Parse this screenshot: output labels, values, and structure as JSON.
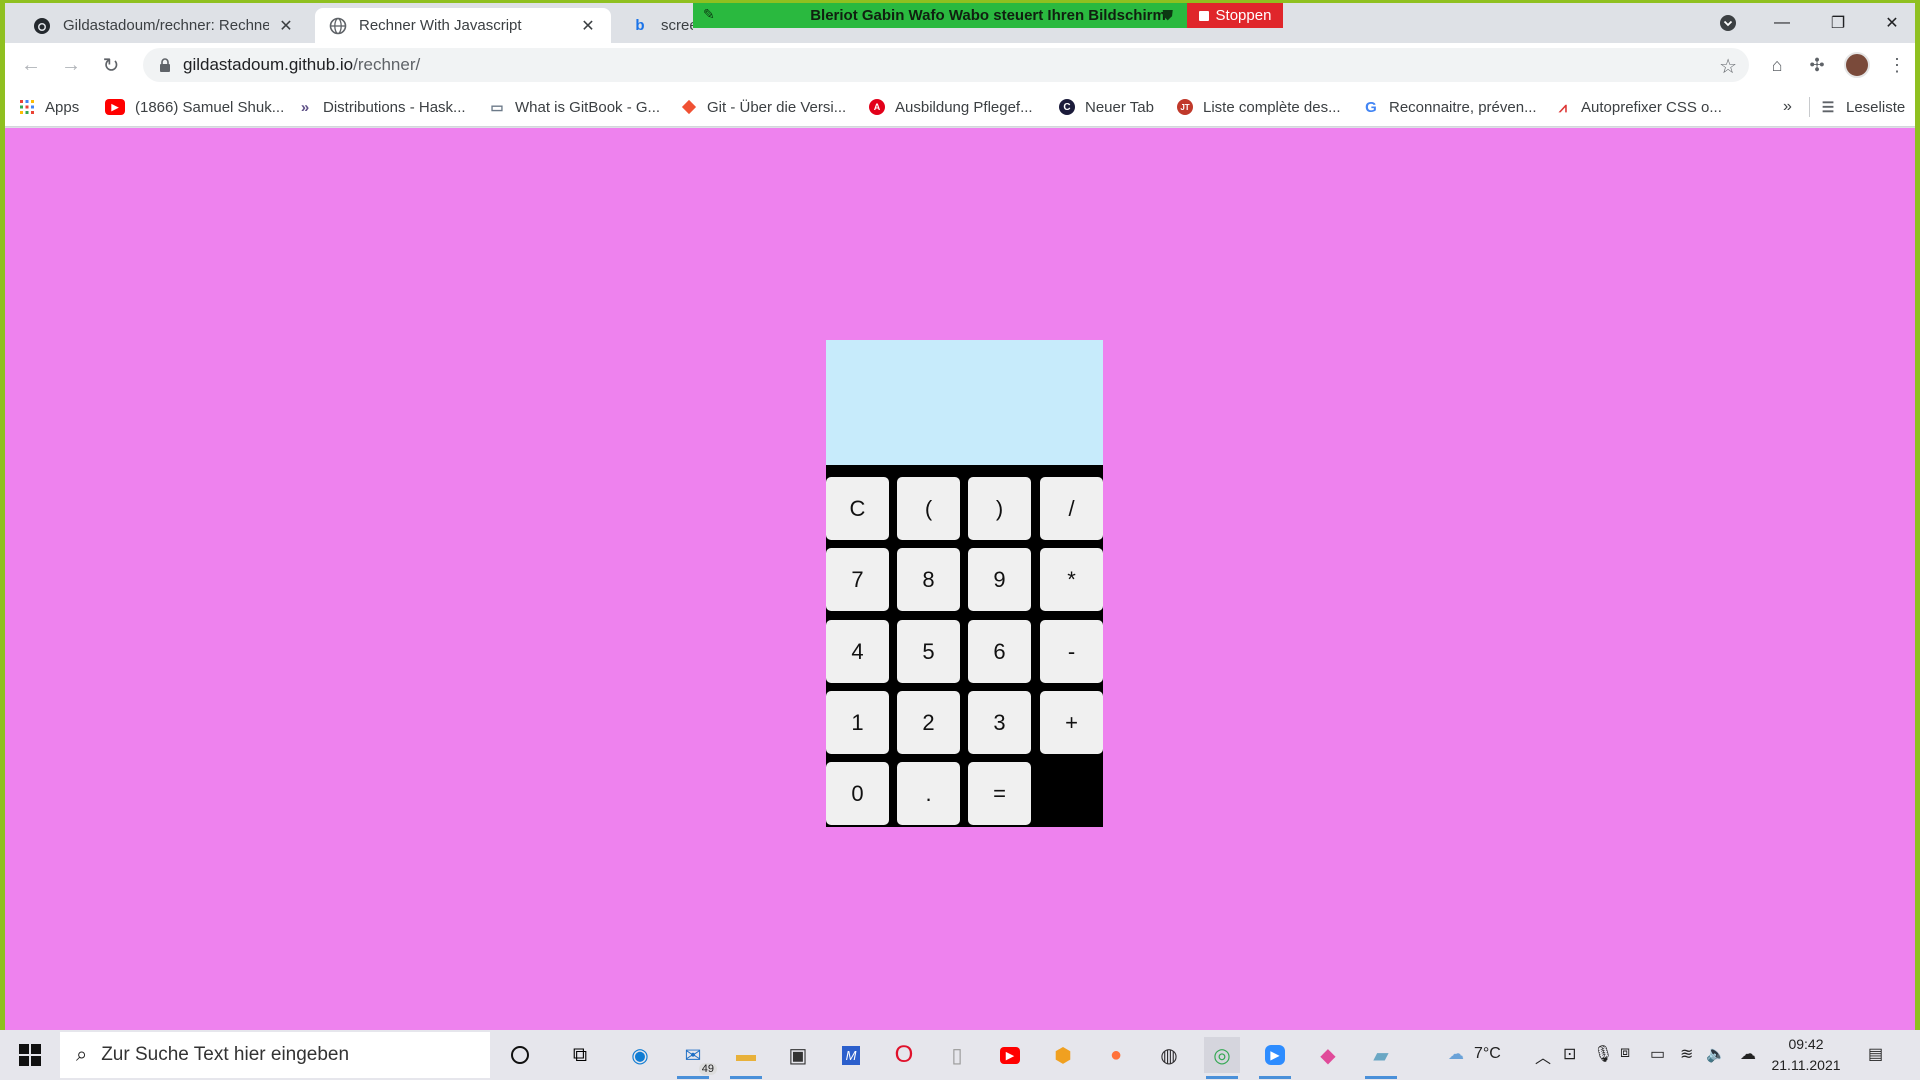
{
  "browser": {
    "tabs": [
      {
        "title": "Gildastadoum/rechner: Rechner",
        "favicon": "github-icon",
        "active": false
      },
      {
        "title": "Rechner With Javascript",
        "favicon": "globe-icon",
        "active": true
      },
      {
        "title": "scree",
        "favicon": "bing-icon",
        "active": false
      }
    ],
    "share_banner": {
      "text": "Bleriot Gabin Wafo Wabo steuert Ihren Bildschirm",
      "stop_label": "Stoppen"
    },
    "address": {
      "host": "gildastadoum.github.io",
      "path": "/rechner/"
    },
    "bookmarks": [
      {
        "label": "Apps",
        "icon": "apps-grid-icon"
      },
      {
        "label": "(1866) Samuel Shuk...",
        "icon": "youtube-icon"
      },
      {
        "label": "Distributions - Hask...",
        "icon": "haskell-icon"
      },
      {
        "label": "What is GitBook - G...",
        "icon": "book-icon"
      },
      {
        "label": "Git - Über die Versi...",
        "icon": "git-icon"
      },
      {
        "label": "Ausbildung Pflegef...",
        "icon": "arbeitsagentur-icon"
      },
      {
        "label": "Neuer Tab",
        "icon": "edge-c-icon"
      },
      {
        "label": "Liste complète des...",
        "icon": "jt-icon"
      },
      {
        "label": "Reconnaitre, préven...",
        "icon": "google-icon"
      },
      {
        "label": "Autoprefixer CSS o...",
        "icon": "autoprefixer-icon"
      }
    ],
    "bookmarks_overflow": "»",
    "reading_list": "Leseliste"
  },
  "calculator": {
    "display_value": "",
    "keys": [
      [
        "C",
        "(",
        ")",
        "/"
      ],
      [
        "7",
        "8",
        "9",
        "*"
      ],
      [
        "4",
        "5",
        "6",
        "-"
      ],
      [
        "1",
        "2",
        "3",
        "+"
      ],
      [
        "0",
        ".",
        "="
      ]
    ]
  },
  "taskbar": {
    "search_placeholder": "Zur Suche Text hier eingeben",
    "mail_badge": "49",
    "weather": "7°C",
    "time": "09:42",
    "date": "21.11.2021"
  },
  "colors": {
    "page_background": "#ee82ee",
    "display_background": "#c7ebfb",
    "keypad_background": "#000000",
    "key_background": "#f0f0f0",
    "share_banner": "#2ab93f",
    "stop_button": "#e0262b"
  }
}
